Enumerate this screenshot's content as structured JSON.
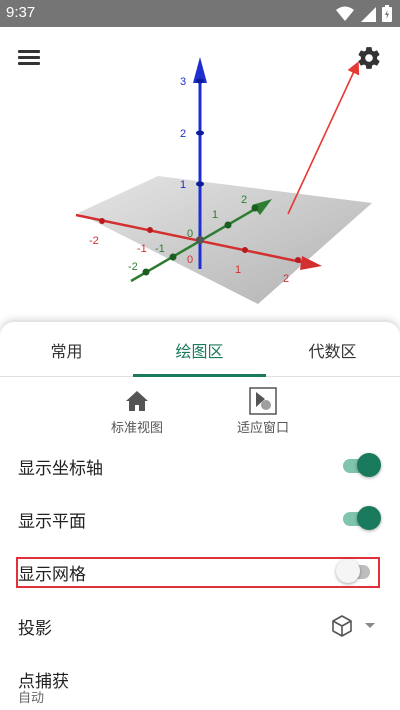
{
  "status_bar": {
    "time": "9:37",
    "icons": [
      "wifi-icon",
      "signal-icon",
      "battery-icon"
    ]
  },
  "graph": {
    "x_ticks": [
      "-2",
      "-1",
      "0",
      "1",
      "2"
    ],
    "y_ticks": [
      "-2",
      "-1",
      "0",
      "1",
      "2"
    ],
    "z_ticks": [
      "1",
      "2",
      "3"
    ],
    "colors": {
      "x_axis": "#d32f2f",
      "y_axis": "#2e7d32",
      "z_axis": "#1e2fd0",
      "plane": "#bdbdbd",
      "annotation_arrow": "#e53935"
    }
  },
  "tabs": [
    {
      "label": "常用"
    },
    {
      "label": "绘图区"
    },
    {
      "label": "代数区"
    }
  ],
  "active_tab": "绘图区",
  "view_buttons": [
    {
      "label": "标准视图",
      "icon": "home-icon"
    },
    {
      "label": "适应窗口",
      "icon": "fit-window-icon"
    }
  ],
  "settings": {
    "show_axes": {
      "label": "显示坐标轴",
      "on": true
    },
    "show_plane": {
      "label": "显示平面",
      "on": true
    },
    "show_grid": {
      "label": "显示网格",
      "on": false
    },
    "projection": {
      "label": "投影",
      "icon": "cube-icon"
    },
    "point_capture": {
      "label": "点捕获",
      "value": "自动"
    }
  },
  "accent_color": "#1a7a5e",
  "highlight_color": "#e0303a"
}
